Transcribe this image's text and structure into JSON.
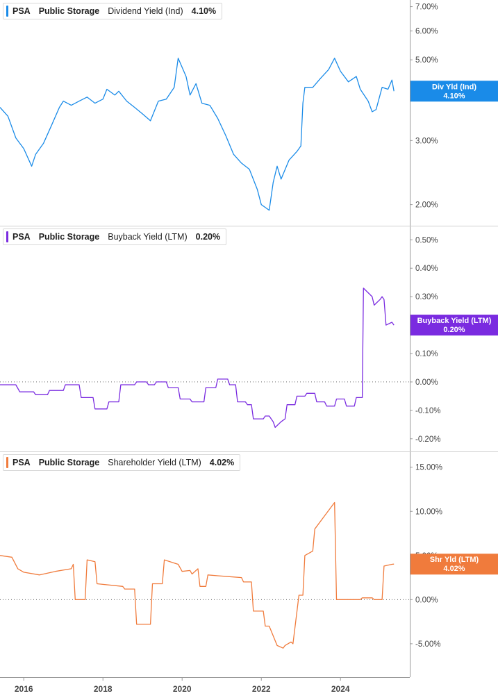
{
  "chart_data": [
    {
      "type": "line",
      "ticker": "PSA",
      "company": "Public Storage",
      "series": [
        {
          "name": "Dividend Yield (Ind)",
          "value_label": "4.10%",
          "tag_label": "Div Yld (Ind)",
          "color": "#1a8be8",
          "x": [
            2015.4,
            2015.6,
            2015.8,
            2016.0,
            2016.2,
            2016.3,
            2016.5,
            2016.7,
            2016.9,
            2017.0,
            2017.2,
            2017.4,
            2017.6,
            2017.8,
            2018.0,
            2018.1,
            2018.3,
            2018.4,
            2018.6,
            2018.8,
            2019.0,
            2019.2,
            2019.4,
            2019.6,
            2019.8,
            2019.9,
            2020.1,
            2020.2,
            2020.35,
            2020.5,
            2020.7,
            2020.9,
            2021.1,
            2021.3,
            2021.5,
            2021.7,
            2021.9,
            2022.0,
            2022.2,
            2022.3,
            2022.4,
            2022.5,
            2022.7,
            2022.9,
            2023.0,
            2023.05,
            2023.1,
            2023.3,
            2023.5,
            2023.7,
            2023.85,
            2024.0,
            2024.2,
            2024.4,
            2024.5,
            2024.7,
            2024.8,
            2024.9,
            2025.05,
            2025.2,
            2025.3,
            2025.35
          ],
          "values": [
            3.7,
            3.5,
            3.05,
            2.85,
            2.55,
            2.75,
            2.95,
            3.3,
            3.7,
            3.85,
            3.75,
            3.85,
            3.95,
            3.8,
            3.9,
            4.15,
            4.0,
            4.1,
            3.85,
            3.7,
            3.55,
            3.4,
            3.85,
            3.9,
            4.2,
            5.05,
            4.5,
            4.0,
            4.3,
            3.8,
            3.75,
            3.45,
            3.1,
            2.75,
            2.6,
            2.5,
            2.2,
            2.0,
            1.93,
            2.3,
            2.55,
            2.35,
            2.65,
            2.8,
            2.9,
            3.8,
            4.2,
            4.2,
            4.45,
            4.7,
            5.05,
            4.65,
            4.35,
            4.5,
            4.15,
            3.85,
            3.6,
            3.65,
            4.2,
            4.15,
            4.4,
            4.1
          ]
        },
        {
          "name": "Buyback Yield (LTM)",
          "value_label": "0.20%",
          "tag_label": "Buyback Yield (LTM)",
          "color": "#7a2be0",
          "x": [
            2015.4,
            2015.8,
            2015.9,
            2016.25,
            2016.3,
            2016.6,
            2016.65,
            2017.0,
            2017.05,
            2017.4,
            2017.45,
            2017.75,
            2017.8,
            2018.1,
            2018.15,
            2018.4,
            2018.45,
            2018.8,
            2018.85,
            2019.1,
            2019.15,
            2019.3,
            2019.35,
            2019.6,
            2019.65,
            2019.9,
            2019.95,
            2020.2,
            2020.25,
            2020.55,
            2020.6,
            2020.85,
            2020.9,
            2021.15,
            2021.2,
            2021.35,
            2021.4,
            2021.6,
            2021.65,
            2021.75,
            2021.8,
            2022.05,
            2022.1,
            2022.2,
            2022.3,
            2022.35,
            2022.5,
            2022.6,
            2022.65,
            2022.85,
            2022.9,
            2023.1,
            2023.15,
            2023.35,
            2023.4,
            2023.6,
            2023.65,
            2023.85,
            2023.9,
            2024.1,
            2024.15,
            2024.35,
            2024.4,
            2024.55,
            2024.58,
            2024.8,
            2024.85,
            2025.0,
            2025.05,
            2025.1,
            2025.15,
            2025.3,
            2025.35
          ],
          "values": [
            -0.01,
            -0.01,
            -0.035,
            -0.035,
            -0.045,
            -0.045,
            -0.03,
            -0.03,
            -0.01,
            -0.01,
            -0.055,
            -0.055,
            -0.095,
            -0.095,
            -0.07,
            -0.07,
            -0.01,
            -0.01,
            0.0,
            0.0,
            -0.01,
            -0.01,
            0.0,
            0.0,
            -0.02,
            -0.02,
            -0.06,
            -0.06,
            -0.07,
            -0.07,
            -0.02,
            -0.02,
            0.01,
            0.01,
            -0.01,
            -0.01,
            -0.07,
            -0.07,
            -0.08,
            -0.08,
            -0.13,
            -0.13,
            -0.12,
            -0.12,
            -0.14,
            -0.16,
            -0.14,
            -0.13,
            -0.08,
            -0.08,
            -0.05,
            -0.05,
            -0.04,
            -0.04,
            -0.07,
            -0.07,
            -0.085,
            -0.085,
            -0.06,
            -0.06,
            -0.085,
            -0.085,
            -0.055,
            -0.055,
            0.33,
            0.3,
            0.27,
            0.29,
            0.3,
            0.29,
            0.2,
            0.21,
            0.2
          ]
        },
        {
          "name": "Shareholder Yield (LTM)",
          "value_label": "4.02%",
          "tag_label": "Shr Yld (LTM)",
          "color": "#f07b3c",
          "x": [
            2015.4,
            2015.7,
            2015.85,
            2016.0,
            2016.4,
            2016.8,
            2017.2,
            2017.25,
            2017.3,
            2017.55,
            2017.6,
            2017.8,
            2017.85,
            2018.5,
            2018.55,
            2018.8,
            2018.85,
            2019.2,
            2019.25,
            2019.5,
            2019.55,
            2019.9,
            2020.0,
            2020.2,
            2020.25,
            2020.4,
            2020.45,
            2020.6,
            2020.65,
            2020.9,
            2021.2,
            2021.5,
            2021.55,
            2021.75,
            2021.8,
            2022.05,
            2022.1,
            2022.2,
            2022.4,
            2022.55,
            2022.6,
            2022.75,
            2022.8,
            2022.95,
            2023.05,
            2023.1,
            2023.3,
            2023.35,
            2023.6,
            2023.85,
            2023.9,
            2024.5,
            2024.55,
            2024.8,
            2024.85,
            2025.05,
            2025.1,
            2025.3,
            2025.35
          ],
          "values": [
            5.0,
            4.8,
            3.5,
            3.1,
            2.8,
            3.2,
            3.5,
            4.0,
            0.0,
            0.0,
            4.5,
            4.3,
            1.8,
            1.5,
            1.2,
            1.2,
            -2.8,
            -2.8,
            1.8,
            1.8,
            4.5,
            4.0,
            3.2,
            3.3,
            2.9,
            3.5,
            1.5,
            1.5,
            2.8,
            2.7,
            2.6,
            2.5,
            2.0,
            2.0,
            -1.3,
            -1.3,
            -3.0,
            -3.0,
            -5.2,
            -5.5,
            -5.2,
            -4.8,
            -5.0,
            0.5,
            0.5,
            5.0,
            5.5,
            8.0,
            9.5,
            11.0,
            0.0,
            0.0,
            0.2,
            0.2,
            0.0,
            0.0,
            3.8,
            4.0,
            4.02
          ]
        }
      ],
      "x_ticks": [
        "2016",
        "2018",
        "2020",
        "2022",
        "2024"
      ],
      "x_tick_values": [
        2016,
        2018,
        2020,
        2022,
        2024
      ],
      "xlim": [
        2015.4,
        2025.75
      ],
      "panels": [
        {
          "ylim": [
            1.75,
            7.3
          ],
          "scale": "log",
          "y_ticks": [
            "7.00%",
            "6.00%",
            "5.00%",
            "4.00%",
            "3.00%",
            "2.00%"
          ],
          "y_tick_values": [
            7,
            6,
            5,
            4,
            3,
            2
          ]
        },
        {
          "ylim": [
            -0.225,
            0.53
          ],
          "scale": "linear",
          "y_ticks": [
            "0.50%",
            "0.40%",
            "0.30%",
            "0.20%",
            "0.10%",
            "0.00%",
            "-0.10%",
            "-0.20%"
          ],
          "y_tick_values": [
            0.5,
            0.4,
            0.3,
            0.2,
            0.1,
            0.0,
            -0.1,
            -0.2
          ],
          "zero_line": true
        },
        {
          "ylim": [
            -8.0,
            16.0
          ],
          "scale": "linear",
          "y_ticks": [
            "15.00%",
            "10.00%",
            "5.00%",
            "0.00%",
            "-5.00%"
          ],
          "y_tick_values": [
            15,
            10,
            5,
            0,
            -5
          ],
          "zero_line": true
        }
      ],
      "grid": false
    }
  ]
}
